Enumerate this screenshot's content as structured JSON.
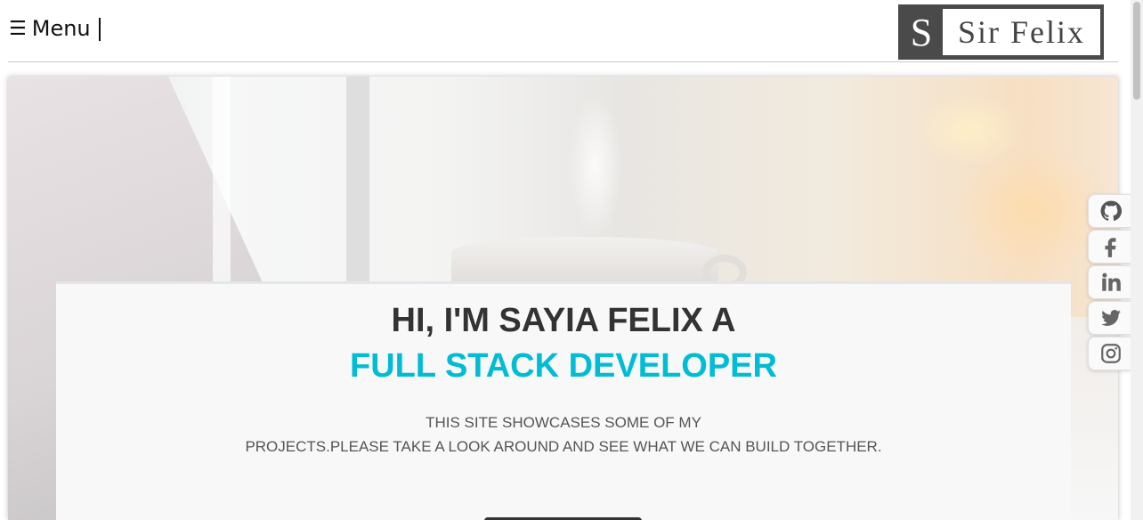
{
  "header": {
    "menu_icon": "☰",
    "menu_label": "Menu",
    "logo_letter": "S",
    "logo_text": "Sir Felix"
  },
  "hero": {
    "title_line1": "HI, I'M SAYIA FELIX A",
    "title_line2": "FULL STACK DEVELOPER",
    "desc_line1": "THIS SITE SHOWCASES SOME OF MY",
    "desc_line2": "PROJECTS.PLEASE TAKE A LOOK AROUND AND SEE WHAT WE CAN BUILD TOGETHER."
  },
  "social": {
    "items": [
      {
        "icon": "github-icon"
      },
      {
        "icon": "facebook-icon"
      },
      {
        "icon": "linkedin-icon"
      },
      {
        "icon": "twitter-icon"
      },
      {
        "icon": "instagram-icon"
      }
    ]
  },
  "colors": {
    "accent": "#00bcd4",
    "heading": "#333333",
    "logo_bg": "#4a4a4a"
  }
}
